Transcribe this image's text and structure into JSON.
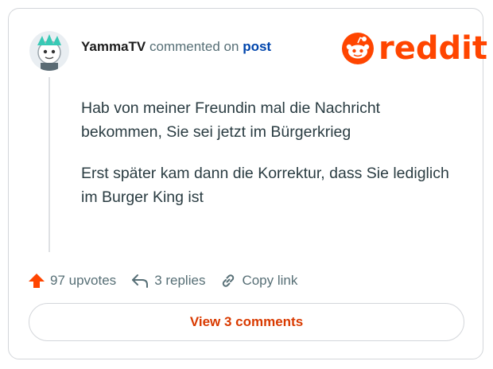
{
  "comment": {
    "username": "YammaTV",
    "commented_on": "commented on",
    "post_link": "post",
    "paragraphs": [
      "Hab von meiner Freundin mal die Nachricht bekommen, Sie sei jetzt im Bürgerkrieg",
      "Erst später kam dann die Korrektur, dass Sie lediglich im Burger King ist"
    ]
  },
  "brand": {
    "logo_text": "reddit",
    "color": "#ff4500"
  },
  "actions": {
    "upvotes": "97 upvotes",
    "replies": "3 replies",
    "copy_link": "Copy link",
    "upvote_color": "#ff4500"
  },
  "view_button": {
    "label": "View 3 comments",
    "color": "#d93a00"
  }
}
